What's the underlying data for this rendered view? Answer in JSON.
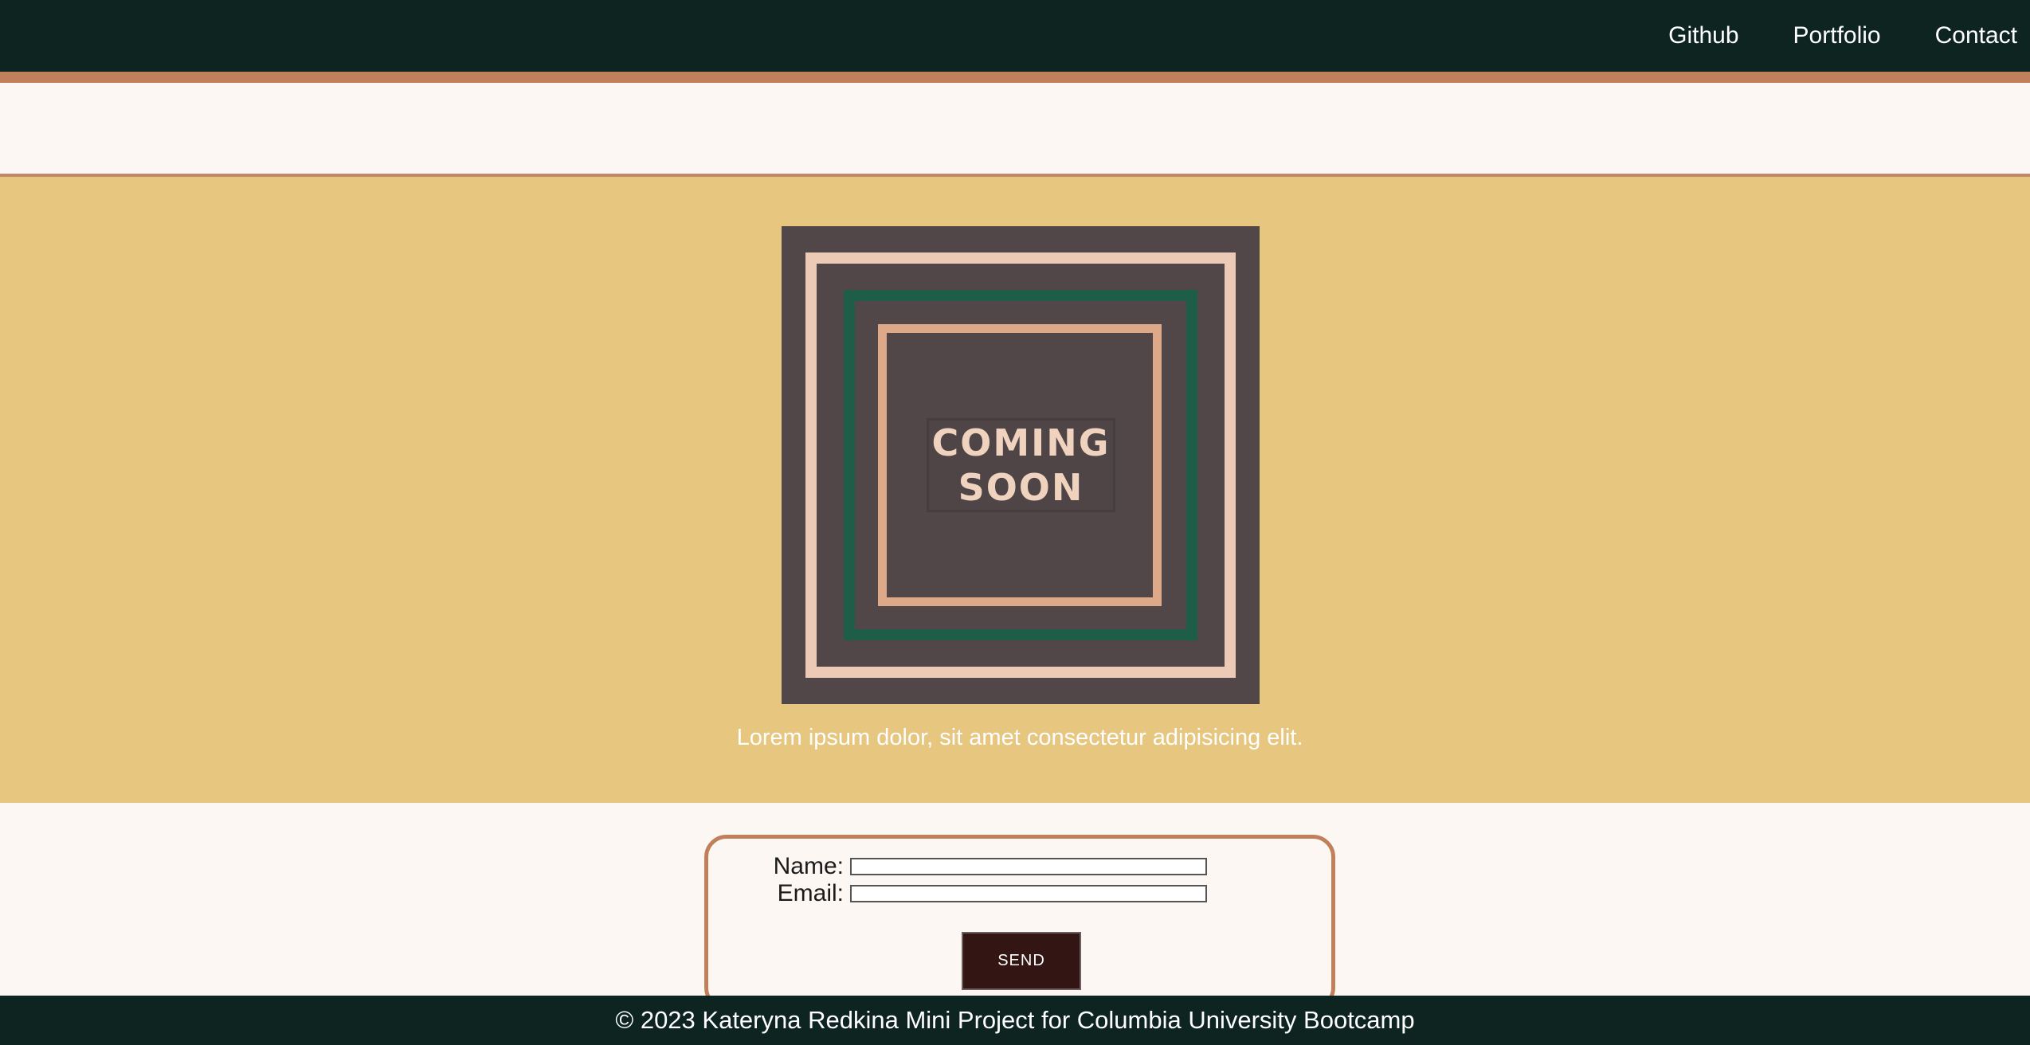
{
  "nav": {
    "items": [
      {
        "label": "Github"
      },
      {
        "label": "Portfolio"
      },
      {
        "label": "Contact"
      }
    ]
  },
  "hero": {
    "placeholder_text": "COMING\nSOON",
    "caption": "Lorem ipsum dolor, sit amet consectetur adipisicing elit."
  },
  "contact_form": {
    "name_label": "Name:",
    "name_value": "",
    "email_label": "Email:",
    "email_value": "",
    "send_label": "SEND"
  },
  "footer": {
    "text": "© 2023 Kateryna Redkina Mini Project for Columbia University Bootcamp"
  },
  "colors": {
    "nav_background": "#0d2420",
    "accent_stripe": "#c0805c",
    "hero_background": "#e7c680",
    "page_background": "#fdf7f4",
    "button_background": "#331514"
  }
}
